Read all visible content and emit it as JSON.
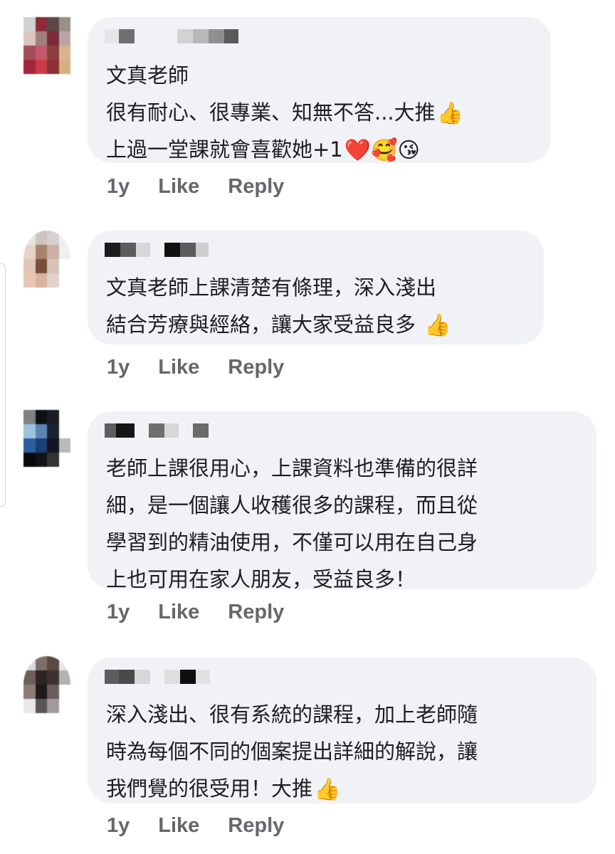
{
  "comments": [
    {
      "lines": [
        "文真老師",
        "很有耐心、很專業、知無不答...大推",
        "上過一堂課就會喜歡她+1"
      ],
      "emoji": [
        "👍",
        "❤️🥰😘"
      ],
      "time": "1y",
      "like": "Like",
      "reply": "Reply"
    },
    {
      "lines": [
        "文真老師上課清楚有條理，深入淺出",
        "結合芳療與經絡，讓大家受益良多"
      ],
      "emoji": [
        "👍"
      ],
      "time": "1y",
      "like": "Like",
      "reply": "Reply"
    },
    {
      "lines": [
        "老師上課很用心，上課資料也準備的很詳",
        "細，是一個讓人收穫很多的課程，而且從",
        "學習到的精油使用，不僅可以用在自己身",
        "上也可用在家人朋友，受益良多！"
      ],
      "time": "1y",
      "like": "Like",
      "reply": "Reply"
    },
    {
      "lines": [
        "深入淺出、很有系統的課程，加上老師隨",
        "時為每個不同的個案提出詳細的解說，讓",
        "我們覺的很受用！大推"
      ],
      "emoji": [
        "👍"
      ],
      "time": "1y",
      "like": "Like",
      "reply": "Reply"
    }
  ],
  "colors": {
    "bubble": "#f0f2f5",
    "action_text": "#65676b",
    "body_text": "#1c1e21"
  },
  "icons": [
    "thumbs-up-emoji",
    "red-heart-emoji",
    "smiling-face-with-hearts-emoji",
    "face-blowing-kiss-emoji"
  ]
}
